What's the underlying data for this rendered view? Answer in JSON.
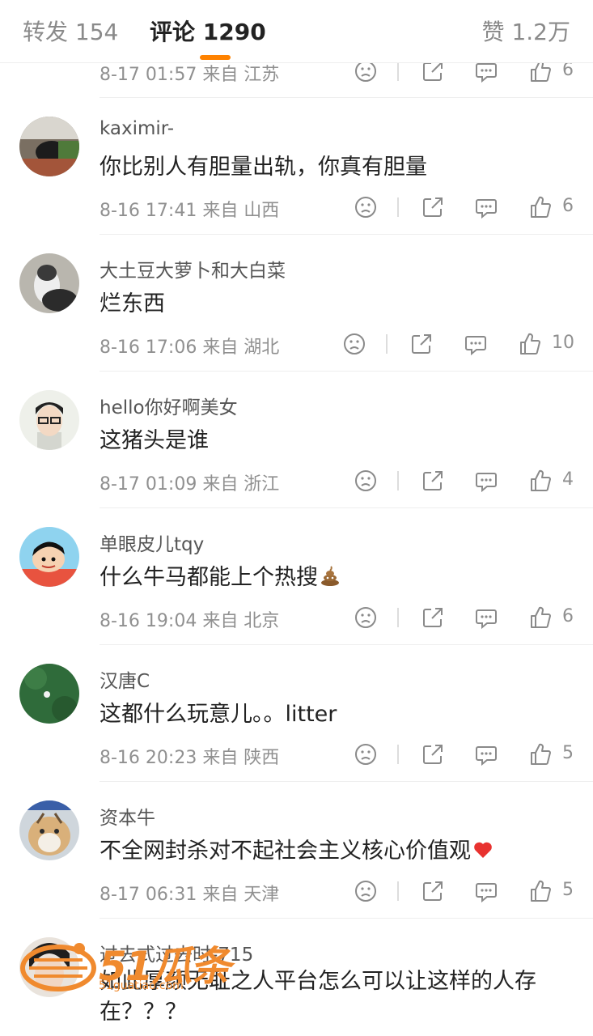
{
  "tabs": {
    "reposts": "转发 154",
    "comments": "评论 1290",
    "likes": "赞 1.2万"
  },
  "colors": {
    "accent": "#ff8200",
    "meta": "#909090",
    "divider": "#eeeeee"
  },
  "icons": [
    "frown-icon",
    "share-icon",
    "comment-icon",
    "thumbs-up-icon"
  ],
  "partial_top": {
    "meta": "8-17 01:57  来自 江苏",
    "likes": "6"
  },
  "comments": [
    {
      "username": "kaximir-",
      "text": "你比别人有胆量出轨，你真有胆量",
      "meta": "8-16 17:41  来自 山西",
      "likes": "6"
    },
    {
      "username": "大土豆大萝卜和大白菜",
      "text": "烂东西",
      "meta": "8-16 17:06  来自 湖北",
      "likes": "10"
    },
    {
      "username": "hello你好啊美女",
      "text": "这猪头是谁",
      "meta": "8-17 01:09  来自 浙江",
      "likes": "4"
    },
    {
      "username": "单眼皮儿tqy",
      "text": "什么牛马都能上个热搜",
      "emoji": "poop-emoji",
      "meta": "8-16 19:04  来自 北京",
      "likes": "6"
    },
    {
      "username": "汉唐C",
      "text": "这都什么玩意儿。。litter",
      "meta": "8-16 20:23  来自 陕西",
      "likes": "5"
    },
    {
      "username": "资本牛",
      "text": "不全网封杀对不起社会主义核心价值观",
      "emoji": "red-heart-emoji",
      "meta": "8-17 06:31  来自 天津",
      "likes": "5"
    },
    {
      "username": "过去式过去时-715",
      "text": "如此厚颜无耻之人平台怎么可以让这样的人存在？？？"
    }
  ],
  "watermark": {
    "brand": "51瓜条",
    "url": "51guatiao.com"
  }
}
